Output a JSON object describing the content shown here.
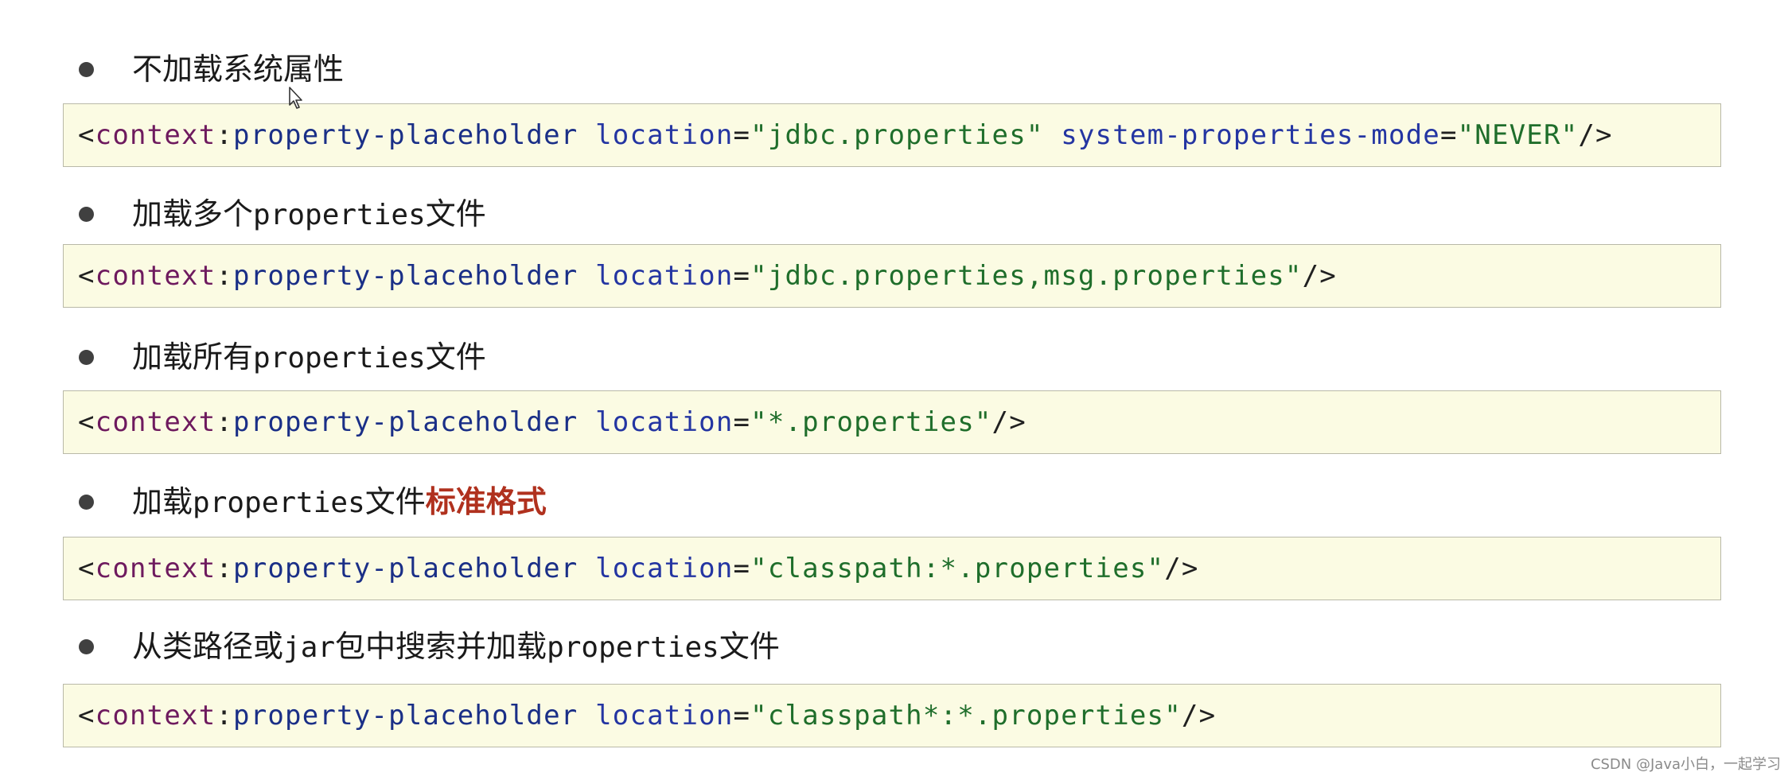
{
  "items": [
    {
      "bullet_cn": "不加载系统属性",
      "code": {
        "open": "<",
        "namespace": "context",
        "colon": ":",
        "tag": "property-placeholder",
        "attr1": "location",
        "eq1": "=",
        "val1": "\"jdbc.properties\"",
        "attr2": "system-properties-mode",
        "eq2": "=",
        "val2": "\"NEVER\"",
        "close": "/>"
      }
    },
    {
      "bullet_pre": "加载多个",
      "bullet_mono": "properties",
      "bullet_post": "文件",
      "code": {
        "open": "<",
        "namespace": "context",
        "colon": ":",
        "tag": "property-placeholder",
        "attr1": "location",
        "eq1": "=",
        "val1": "\"jdbc.properties,msg.properties\"",
        "close": "/>"
      }
    },
    {
      "bullet_pre": "加载所有",
      "bullet_mono": "properties",
      "bullet_post": "文件",
      "code": {
        "open": "<",
        "namespace": "context",
        "colon": ":",
        "tag": "property-placeholder",
        "attr1": "location",
        "eq1": "=",
        "val1": "\"*.properties\"",
        "close": "/>"
      }
    },
    {
      "bullet_pre": "加载",
      "bullet_mono": "properties",
      "bullet_post": "文件",
      "bullet_highlight": "标准格式",
      "code": {
        "open": "<",
        "namespace": "context",
        "colon": ":",
        "tag": "property-placeholder",
        "attr1": "location",
        "eq1": "=",
        "val1": "\"classpath:*.properties\"",
        "close": "/>"
      }
    },
    {
      "bullet_pre": "从类路径或",
      "bullet_mono": "jar",
      "bullet_mid": "包中搜索并加载",
      "bullet_mono2": "properties",
      "bullet_post": "文件",
      "code": {
        "open": "<",
        "namespace": "context",
        "colon": ":",
        "tag": "property-placeholder",
        "attr1": "location",
        "eq1": "=",
        "val1": "\"classpath*:*.properties\"",
        "close": "/>"
      }
    }
  ],
  "watermark": "CSDN @Java小白，一起学习",
  "colors": {
    "code_background": "#fbfbe3",
    "namespace": "#6e1a5e",
    "tag": "#1a2f87",
    "attribute": "#2435a2",
    "value": "#1f6e2b",
    "highlight": "#b0311e"
  },
  "icons": {
    "cursor": "mouse-pointer-icon"
  }
}
